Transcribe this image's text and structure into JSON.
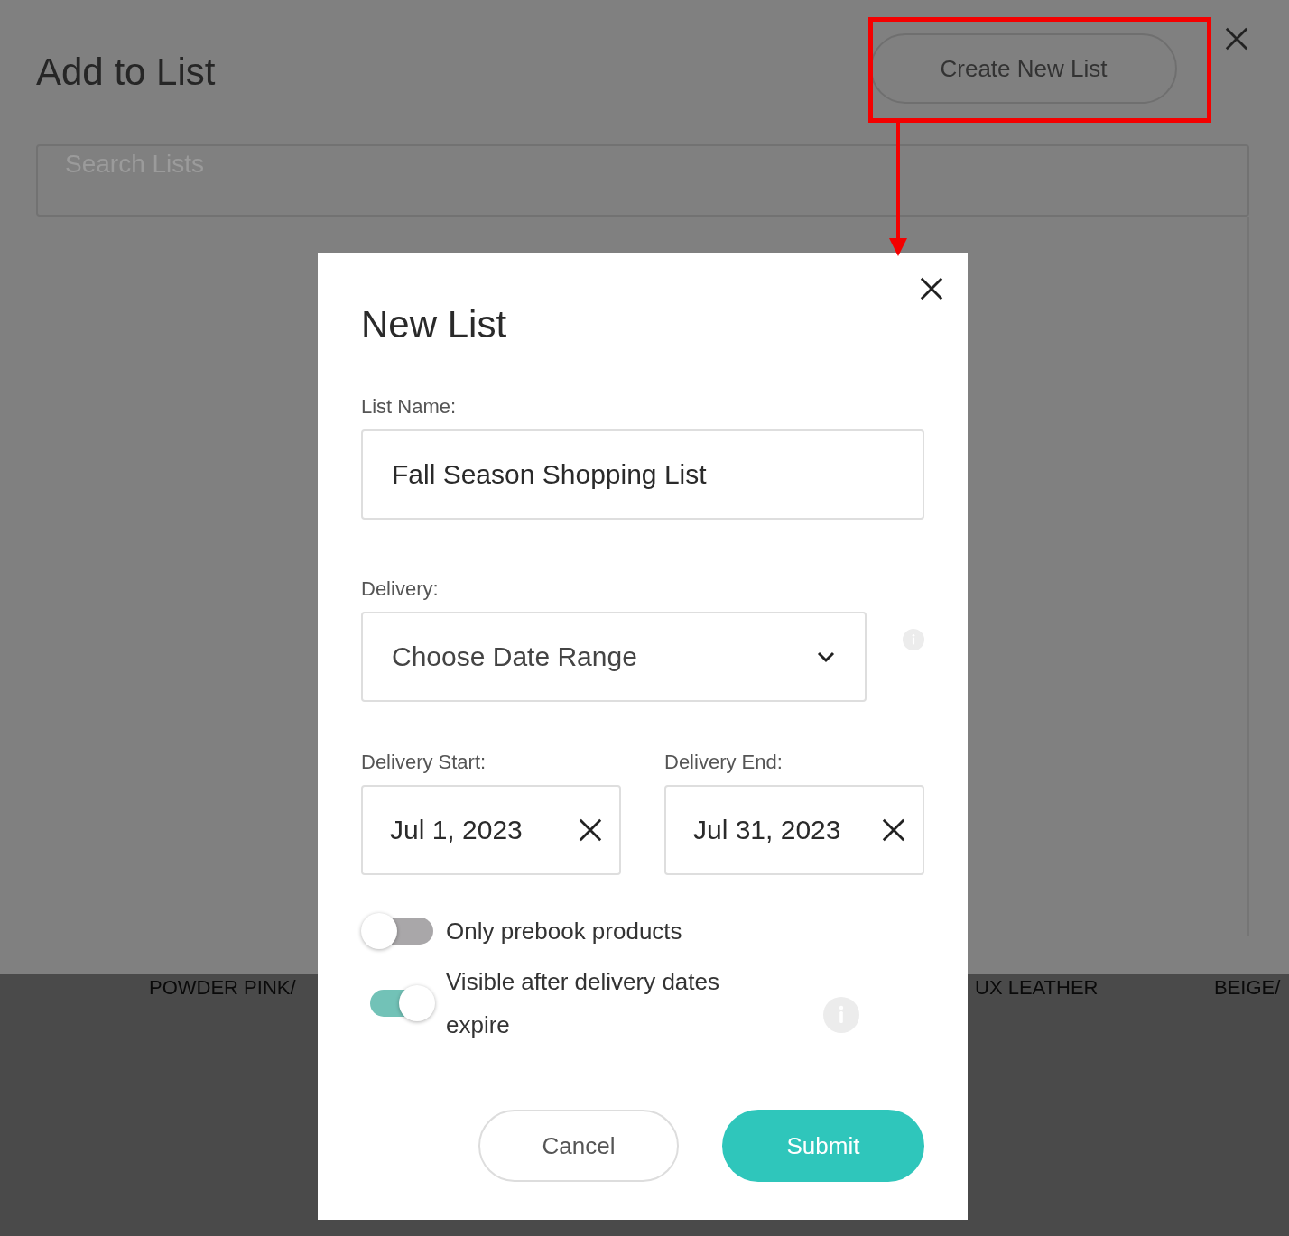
{
  "background": {
    "title": "Add to List",
    "create_button": "Create New List",
    "search": {
      "placeholder": "Search Lists"
    },
    "product_labels": [
      "POWDER PINK/",
      "UX LEATHER",
      "BEIGE/"
    ]
  },
  "dialog": {
    "title": "New List",
    "list_name": {
      "label": "List Name:",
      "value": "Fall Season Shopping List"
    },
    "delivery": {
      "label": "Delivery:",
      "value": "Choose Date Range"
    },
    "delivery_start": {
      "label": "Delivery Start:",
      "value": "Jul 1, 2023"
    },
    "delivery_end": {
      "label": "Delivery End:",
      "value": "Jul 31, 2023"
    },
    "toggles": [
      {
        "label": "Only prebook products",
        "on": false,
        "info": false
      },
      {
        "label": "Visible after delivery dates expire",
        "on": true,
        "info": true
      }
    ],
    "buttons": [
      {
        "label": "Cancel",
        "kind": "secondary"
      },
      {
        "label": "Submit",
        "kind": "primary"
      }
    ]
  }
}
